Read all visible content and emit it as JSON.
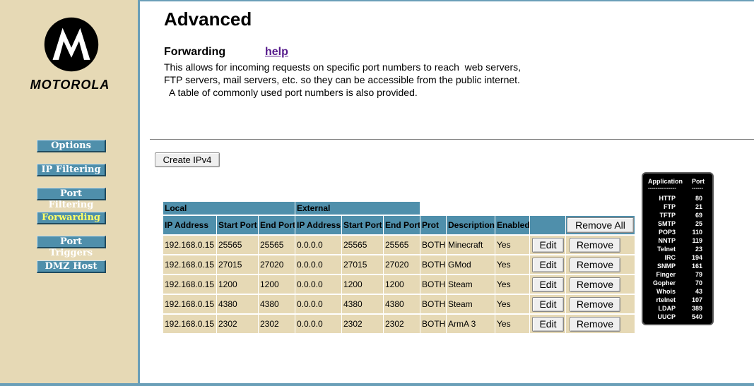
{
  "brand": {
    "name": "MOTOROLA",
    "logo_icon": "motorola-batwing-logo-icon",
    "colors": {
      "sidebar_bg": "#e6d9b5",
      "accent": "#4f8fab",
      "active_nav_text": "#ffff66"
    }
  },
  "sidebar": {
    "items": [
      {
        "label": "Options",
        "active": false
      },
      {
        "label": "IP Filtering",
        "active": false
      },
      {
        "label": "Port Filtering",
        "active": false
      },
      {
        "label": "Forwarding",
        "active": true
      },
      {
        "label": "Port Triggers",
        "active": false
      },
      {
        "label": "DMZ Host",
        "active": false
      }
    ]
  },
  "header": {
    "title": "Advanced",
    "section_title": "Forwarding",
    "help_label": "help",
    "description_lines": [
      "This allows for incoming requests on specific port numbers to reach  web servers,",
      "FTP servers, mail servers, etc. so they can be accessible from the public internet.",
      "  A table of commonly used port numbers is also provided."
    ]
  },
  "actions": {
    "create_label": "Create IPv4",
    "remove_all_label": "Remove All"
  },
  "table": {
    "groups": {
      "local": "Local",
      "external": "External"
    },
    "columns": [
      "IP Address",
      "Start Port",
      "End Port",
      "IP Address",
      "Start Port",
      "End Port",
      "Prot",
      "Description",
      "Enabled"
    ],
    "edit_label": "Edit",
    "remove_label": "Remove",
    "rows": [
      {
        "local_ip": "192.168.0.15",
        "local_start": "25565",
        "local_end": "25565",
        "ext_ip": "0.0.0.0",
        "ext_start": "25565",
        "ext_end": "25565",
        "prot": "BOTH",
        "description": "Minecraft",
        "enabled": "Yes"
      },
      {
        "local_ip": "192.168.0.15",
        "local_start": "27015",
        "local_end": "27020",
        "ext_ip": "0.0.0.0",
        "ext_start": "27015",
        "ext_end": "27020",
        "prot": "BOTH",
        "description": "GMod",
        "enabled": "Yes"
      },
      {
        "local_ip": "192.168.0.15",
        "local_start": "1200",
        "local_end": "1200",
        "ext_ip": "0.0.0.0",
        "ext_start": "1200",
        "ext_end": "1200",
        "prot": "BOTH",
        "description": "Steam",
        "enabled": "Yes"
      },
      {
        "local_ip": "192.168.0.15",
        "local_start": "4380",
        "local_end": "4380",
        "ext_ip": "0.0.0.0",
        "ext_start": "4380",
        "ext_end": "4380",
        "prot": "BOTH",
        "description": "Steam",
        "enabled": "Yes"
      },
      {
        "local_ip": "192.168.0.15",
        "local_start": "2302",
        "local_end": "2302",
        "ext_ip": "0.0.0.0",
        "ext_start": "2302",
        "ext_end": "2302",
        "prot": "BOTH",
        "description": "ArmA 3",
        "enabled": "Yes"
      }
    ]
  },
  "port_reference": {
    "headers": {
      "app": "Application",
      "port": "Port"
    },
    "separators": {
      "app": "---------------",
      "port": "------"
    },
    "rows": [
      {
        "app": "HTTP",
        "port": "80"
      },
      {
        "app": "FTP",
        "port": "21"
      },
      {
        "app": "TFTP",
        "port": "69"
      },
      {
        "app": "SMTP",
        "port": "25"
      },
      {
        "app": "POP3",
        "port": "110"
      },
      {
        "app": "NNTP",
        "port": "119"
      },
      {
        "app": "Telnet",
        "port": "23"
      },
      {
        "app": "IRC",
        "port": "194"
      },
      {
        "app": "SNMP",
        "port": "161"
      },
      {
        "app": "Finger",
        "port": "79"
      },
      {
        "app": "Gopher",
        "port": "70"
      },
      {
        "app": "Whois",
        "port": "43"
      },
      {
        "app": "rtelnet",
        "port": "107"
      },
      {
        "app": "LDAP",
        "port": "389"
      },
      {
        "app": "UUCP",
        "port": "540"
      }
    ]
  }
}
